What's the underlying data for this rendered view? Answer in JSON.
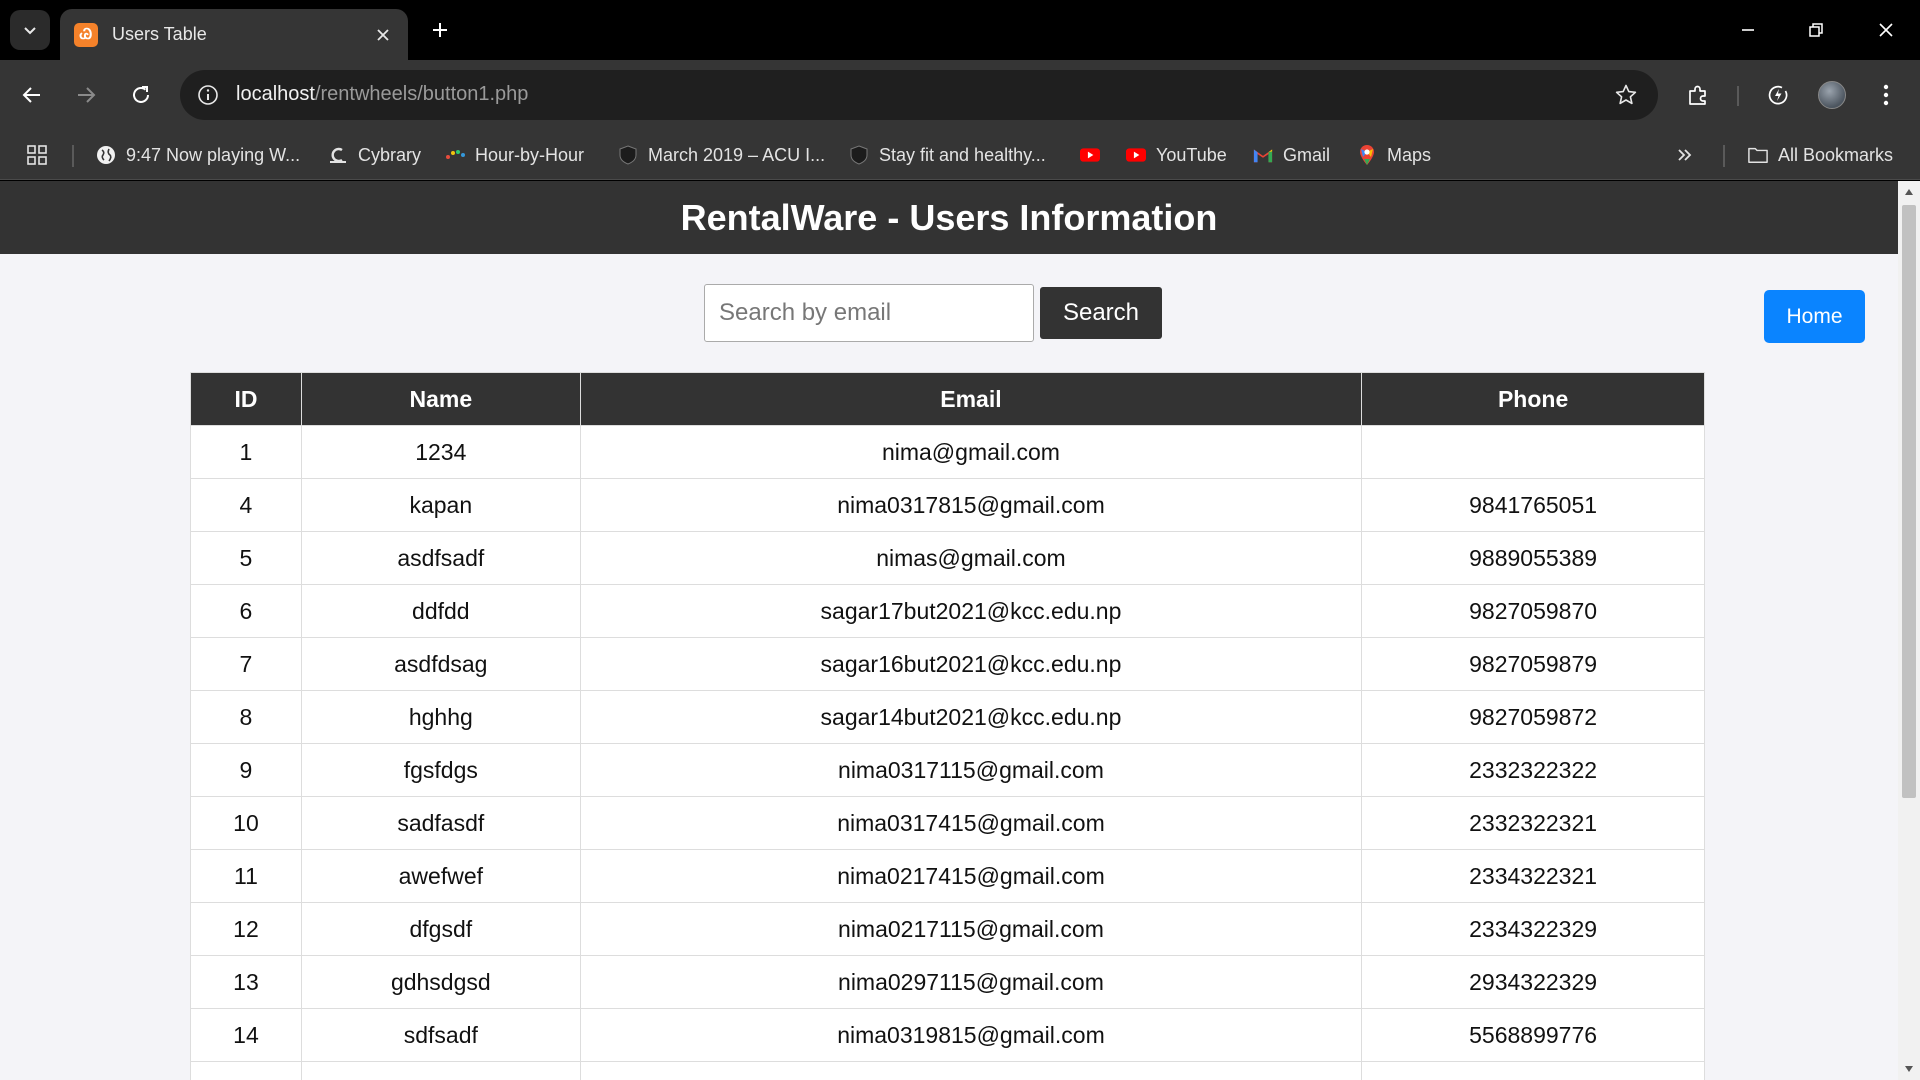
{
  "browser": {
    "tab_title": "Users Table",
    "tab_favicon_glyph": "Ꮚ",
    "url_host": "localhost",
    "url_path": "/rentwheels/button1.php"
  },
  "bookmarks": {
    "items": [
      {
        "label": "9:47 Now playing W...",
        "icon": "globe-icon"
      },
      {
        "label": "Cybrary",
        "icon": "cybrary-icon"
      },
      {
        "label": "Hour-by-Hour",
        "icon": "hour-by-hour-icon"
      },
      {
        "label": "March 2019 – ACU I...",
        "icon": "shield-icon"
      },
      {
        "label": "Stay fit and healthy...",
        "icon": "shield-icon"
      },
      {
        "label": "",
        "icon": "youtube-icon"
      },
      {
        "label": "YouTube",
        "icon": "youtube-icon"
      },
      {
        "label": "Gmail",
        "icon": "gmail-icon"
      },
      {
        "label": "Maps",
        "icon": "maps-icon"
      }
    ],
    "all_bookmarks_label": "All Bookmarks"
  },
  "page": {
    "title": "RentalWare - Users Information",
    "search_placeholder": "Search by email",
    "search_value": "",
    "search_button": "Search",
    "home_button": "Home"
  },
  "table": {
    "headers": [
      "ID",
      "Name",
      "Email",
      "Phone"
    ],
    "rows": [
      [
        "1",
        "1234",
        "nima@gmail.com",
        ""
      ],
      [
        "4",
        "kapan",
        "nima0317815@gmail.com",
        "9841765051"
      ],
      [
        "5",
        "asdfsadf",
        "nimas@gmail.com",
        "9889055389"
      ],
      [
        "6",
        "ddfdd",
        "sagar17but2021@kcc.edu.np",
        "9827059870"
      ],
      [
        "7",
        "asdfdsag",
        "sagar16but2021@kcc.edu.np",
        "9827059879"
      ],
      [
        "8",
        "hghhg",
        "sagar14but2021@kcc.edu.np",
        "9827059872"
      ],
      [
        "9",
        "fgsfdgs",
        "nima0317115@gmail.com",
        "2332322322"
      ],
      [
        "10",
        "sadfasdf",
        "nima0317415@gmail.com",
        "2332322321"
      ],
      [
        "11",
        "awefwef",
        "nima0217415@gmail.com",
        "2334322321"
      ],
      [
        "12",
        "dfgsdf",
        "nima0217115@gmail.com",
        "2334322329"
      ],
      [
        "13",
        "gdhsdgsd",
        "nima0297115@gmail.com",
        "2934322329"
      ],
      [
        "14",
        "sdfsadf",
        "nima0319815@gmail.com",
        "5568899776"
      ],
      [
        "",
        "",
        "",
        ""
      ]
    ]
  },
  "colors": {
    "header_bg": "#333333",
    "page_bg": "#f4f4f8",
    "home_button": "#0a84ff"
  }
}
